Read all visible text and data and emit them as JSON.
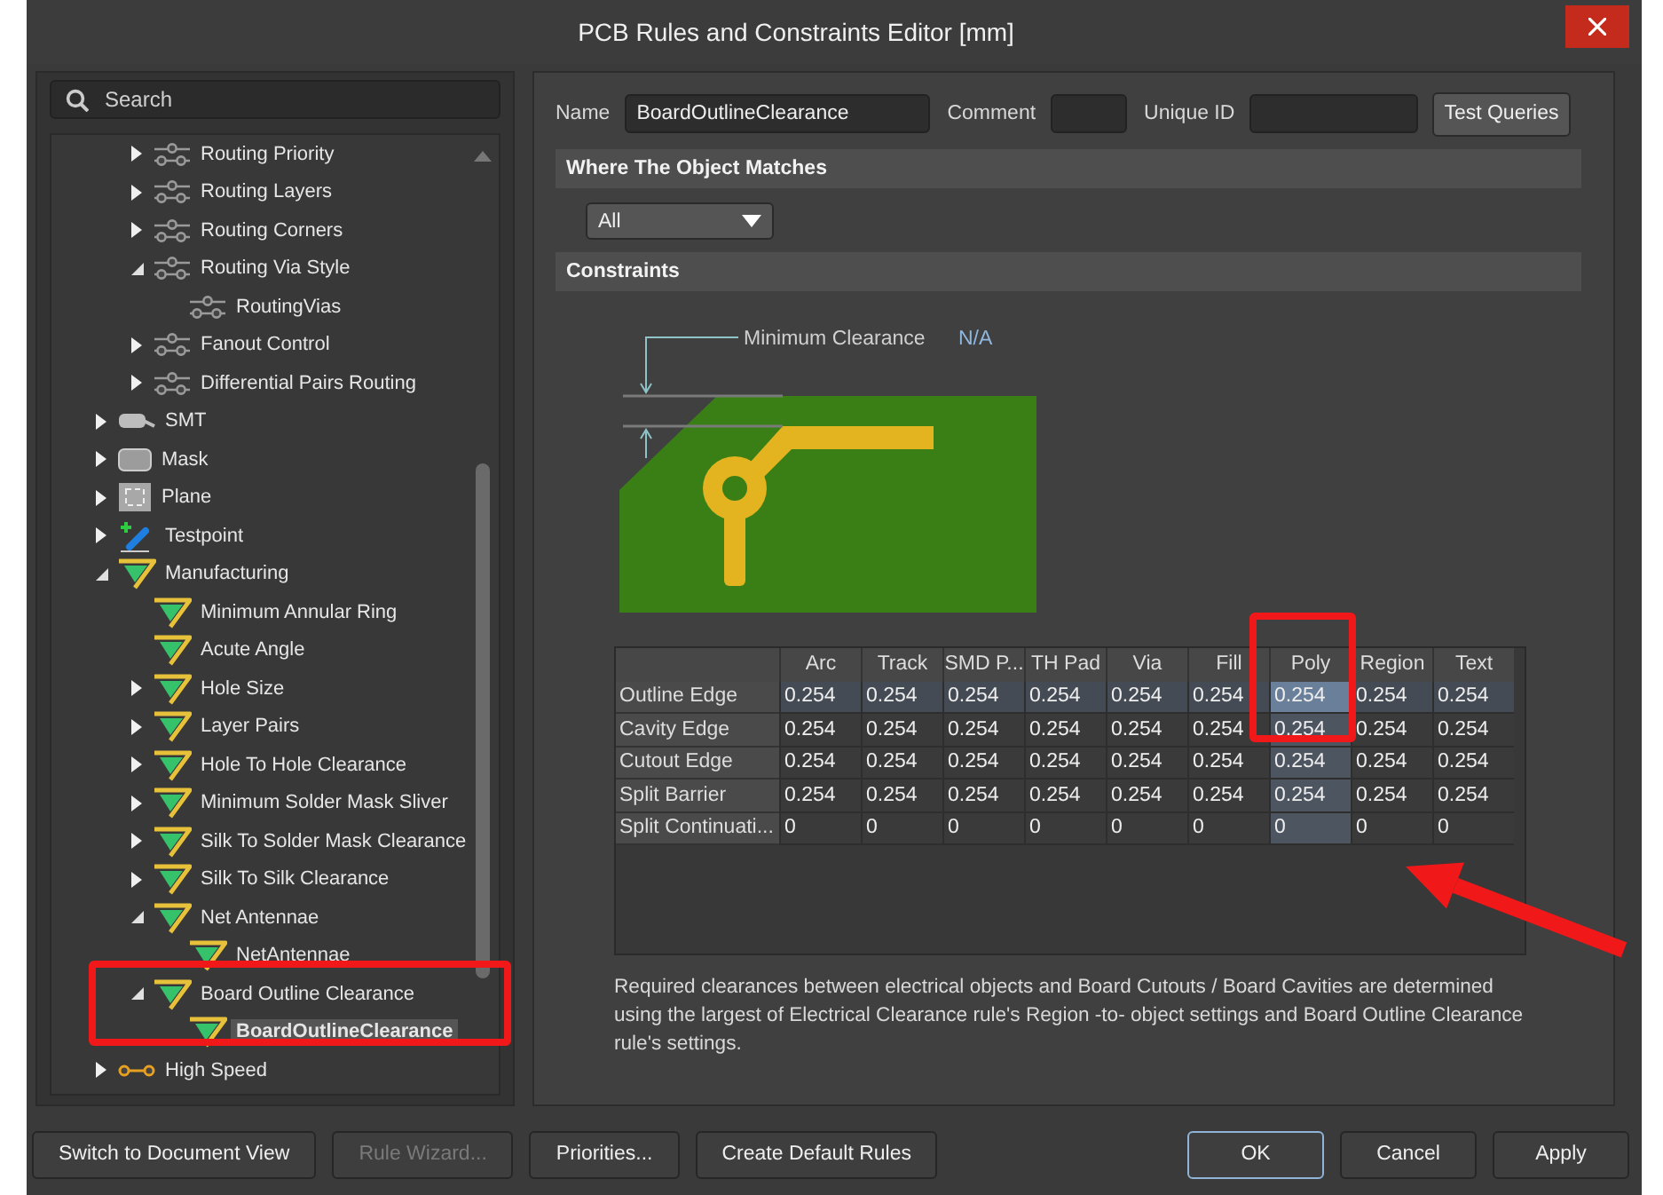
{
  "window": {
    "title": "PCB Rules and Constraints Editor [mm]"
  },
  "search": {
    "placeholder": "Search"
  },
  "tree": {
    "scrolled_parent_children": [
      {
        "label": "Routing Priority",
        "kind": "routing",
        "expanded": false,
        "selected": false
      },
      {
        "label": "Routing Layers",
        "kind": "routing",
        "expanded": false,
        "selected": false
      },
      {
        "label": "Routing Corners",
        "kind": "routing",
        "expanded": false,
        "selected": false
      },
      {
        "label": "Routing Via Style",
        "kind": "routing",
        "expanded": true,
        "selected": false,
        "children": [
          {
            "label": "RoutingVias",
            "kind": "routing",
            "selected": false
          }
        ]
      },
      {
        "label": "Fanout Control",
        "kind": "routing",
        "expanded": false,
        "selected": false
      },
      {
        "label": "Differential Pairs Routing",
        "kind": "routing",
        "expanded": false,
        "selected": false
      }
    ],
    "items": [
      {
        "label": "SMT",
        "kind": "smt",
        "expanded": false,
        "selected": false
      },
      {
        "label": "Mask",
        "kind": "mask",
        "expanded": false,
        "selected": false
      },
      {
        "label": "Plane",
        "kind": "plane",
        "expanded": false,
        "selected": false
      },
      {
        "label": "Testpoint",
        "kind": "testpoint",
        "expanded": false,
        "selected": false
      },
      {
        "label": "Manufacturing",
        "kind": "manufacturing",
        "expanded": true,
        "selected": false,
        "children": [
          {
            "label": "Minimum Annular Ring",
            "kind": "manufacturing",
            "selected": false
          },
          {
            "label": "Acute Angle",
            "kind": "manufacturing",
            "selected": false
          },
          {
            "label": "Hole Size",
            "kind": "manufacturing",
            "expanded": false,
            "selected": false
          },
          {
            "label": "Layer Pairs",
            "kind": "manufacturing",
            "expanded": false,
            "selected": false
          },
          {
            "label": "Hole To Hole Clearance",
            "kind": "manufacturing",
            "expanded": false,
            "selected": false
          },
          {
            "label": "Minimum Solder Mask Sliver",
            "kind": "manufacturing",
            "expanded": false,
            "selected": false
          },
          {
            "label": "Silk To Solder Mask Clearance",
            "kind": "manufacturing",
            "expanded": false,
            "selected": false
          },
          {
            "label": "Silk To Silk Clearance",
            "kind": "manufacturing",
            "expanded": false,
            "selected": false
          },
          {
            "label": "Net Antennae",
            "kind": "manufacturing",
            "expanded": true,
            "selected": false,
            "children": [
              {
                "label": "NetAntennae",
                "kind": "manufacturing",
                "selected": false
              }
            ]
          },
          {
            "label": "Board Outline Clearance",
            "kind": "manufacturing",
            "expanded": true,
            "selected": false,
            "children": [
              {
                "label": "BoardOutlineClearance",
                "kind": "manufacturing",
                "selected": true
              }
            ]
          }
        ]
      },
      {
        "label": "High Speed",
        "kind": "highspeed",
        "expanded": false,
        "selected": false
      }
    ]
  },
  "rule": {
    "name_label": "Name",
    "name": "BoardOutlineClearance",
    "comment_label": "Comment",
    "unique_id_label": "Unique ID",
    "test_button": "Test Queries"
  },
  "where_section": {
    "title": "Where The Object Matches",
    "scope": "All"
  },
  "constraints": {
    "title": "Constraints",
    "diagram_label": "Minimum Clearance",
    "diagram_value": "N/A",
    "columns": [
      {
        "label": "Arc",
        "selected": false
      },
      {
        "label": "Track",
        "selected": false
      },
      {
        "label": "SMD P...",
        "selected": false
      },
      {
        "label": "TH Pad",
        "selected": false
      },
      {
        "label": "Via",
        "selected": false
      },
      {
        "label": "Fill",
        "selected": false
      },
      {
        "label": "Poly",
        "selected": true
      },
      {
        "label": "Region",
        "selected": false
      },
      {
        "label": "Text",
        "selected": false
      }
    ],
    "rows": [
      {
        "label": "Outline Edge",
        "selected": true,
        "cells": [
          "0.254",
          "0.254",
          "0.254",
          "0.254",
          "0.254",
          "0.254",
          "0.254",
          "0.254",
          "0.254"
        ]
      },
      {
        "label": "Cavity Edge",
        "selected": false,
        "cells": [
          "0.254",
          "0.254",
          "0.254",
          "0.254",
          "0.254",
          "0.254",
          "0.254",
          "0.254",
          "0.254"
        ]
      },
      {
        "label": "Cutout Edge",
        "selected": false,
        "cells": [
          "0.254",
          "0.254",
          "0.254",
          "0.254",
          "0.254",
          "0.254",
          "0.254",
          "0.254",
          "0.254"
        ]
      },
      {
        "label": "Split Barrier",
        "selected": false,
        "cells": [
          "0.254",
          "0.254",
          "0.254",
          "0.254",
          "0.254",
          "0.254",
          "0.254",
          "0.254",
          "0.254"
        ]
      },
      {
        "label": "Split Continuati...",
        "selected": false,
        "cells": [
          "0",
          "0",
          "0",
          "0",
          "0",
          "0",
          "0",
          "0",
          "0"
        ]
      }
    ],
    "description": "Required clearances between electrical objects and Board Cutouts / Board Cavities are determined using the largest of Electrical Clearance rule's Region -to- object settings and Board Outline Clearance rule's settings."
  },
  "footer": {
    "left_buttons": [
      {
        "label": "Switch to Document View",
        "disabled": false
      },
      {
        "label": "Rule Wizard...",
        "disabled": true
      },
      {
        "label": "Priorities...",
        "disabled": false
      },
      {
        "label": "Create Default Rules",
        "disabled": false
      }
    ],
    "right_buttons": [
      {
        "label": "OK",
        "focused": true
      },
      {
        "label": "Cancel",
        "focused": false
      },
      {
        "label": "Apply",
        "focused": false
      }
    ]
  }
}
